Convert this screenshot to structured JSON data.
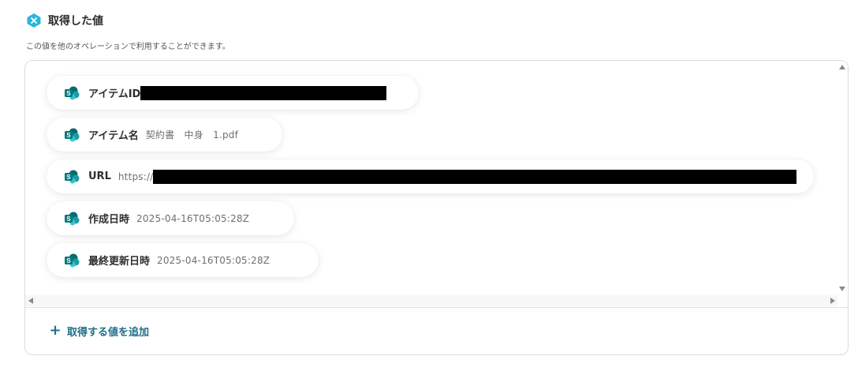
{
  "section": {
    "title": "取得した値",
    "description": "この値を他のオペレーションで利用することができます。",
    "badge_icon": "x-badge-icon",
    "badge_color": "#29b6d9"
  },
  "items": [
    {
      "label": "アイテムID",
      "value": "",
      "redacted": true
    },
    {
      "label": "アイテム名",
      "value": "契約書　中身　1.pdf",
      "redacted": false
    },
    {
      "label": "URL",
      "value": "https://",
      "redacted": true
    },
    {
      "label": "作成日時",
      "value": "2025-04-16T05:05:28Z",
      "redacted": false
    },
    {
      "label": "最終更新日時",
      "value": "2025-04-16T05:05:28Z",
      "redacted": false
    }
  ],
  "item_icon": "sharepoint-icon",
  "add_button": {
    "label": "取得する値を追加",
    "icon": "plus-icon",
    "color": "#1e6d8a"
  }
}
